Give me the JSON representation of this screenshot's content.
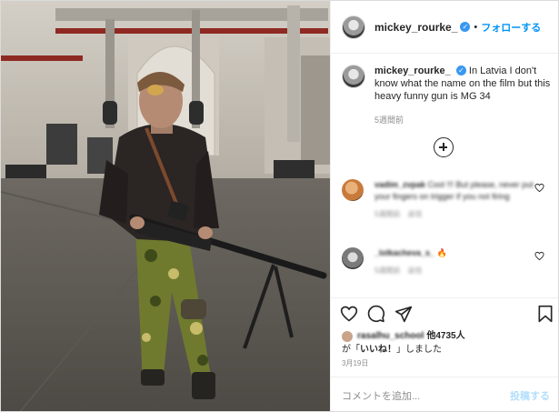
{
  "post": {
    "username": "mickey_rourke_",
    "verified_icon": "verified-badge-icon",
    "dot": "•",
    "follow_label": "フォローする",
    "caption_text": "In Latvia I don't know what the name on the film but this heavy funny gun is MG 34",
    "time_ago": "5週間前"
  },
  "comments": [
    {
      "username": "vadim_zvpak",
      "text": "Cool !!! But please, never put your fingers on trigger if you not firing",
      "meta": "5週間前　返信",
      "avatar_color": "#c87a3c"
    },
    {
      "username": "_lolkacheva_s_",
      "text": "🔥",
      "meta": "5週間前　返信",
      "avatar_color": "#555555"
    }
  ],
  "actions": {
    "like_icon": "heart-icon",
    "comment_icon": "comment-icon",
    "share_icon": "share-icon",
    "save_icon": "bookmark-icon"
  },
  "likes": {
    "by_user": "rasalhu_school",
    "others_label": "他4735人",
    "suffix_prefix": "が「",
    "suffix_bold": "いいね！",
    "suffix_end": "」しました"
  },
  "date": "3月19日",
  "add_comment": {
    "placeholder": "コメントを追加...",
    "post_label": "投稿する"
  },
  "colors": {
    "accent": "#0095f6",
    "verified": "#3897f0",
    "muted": "#8e8e8e"
  }
}
